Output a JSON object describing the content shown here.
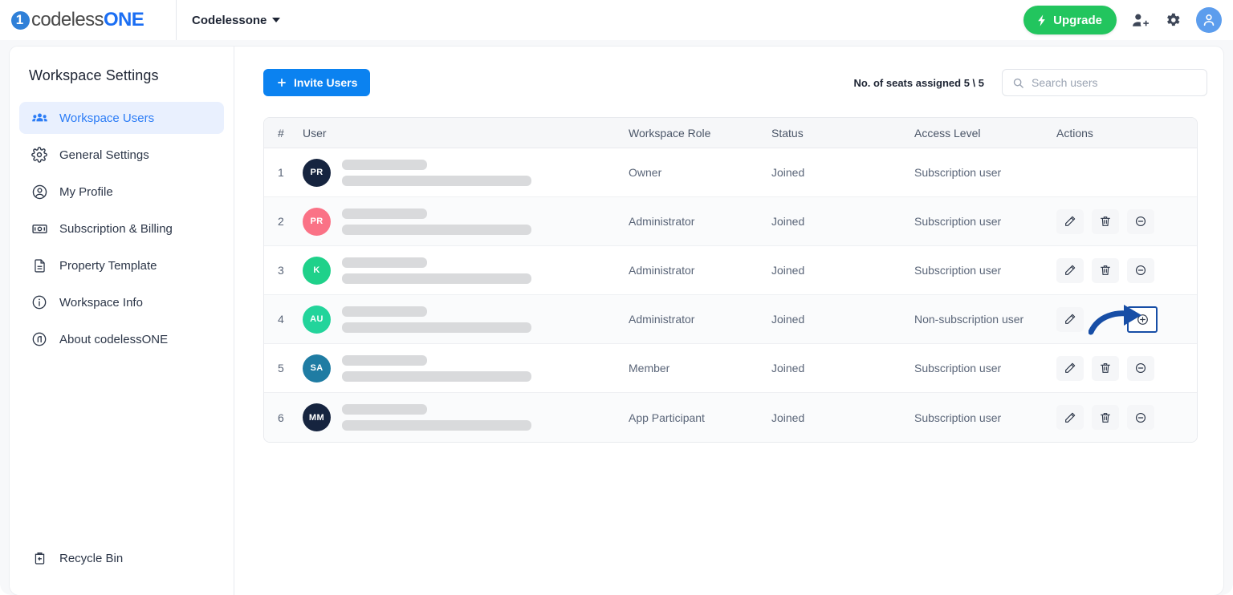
{
  "topbar": {
    "logo_part1": "codeless",
    "logo_part2": "ONE",
    "logo_mark_digit": "1",
    "workspace_name": "Codelessone",
    "upgrade_label": "Upgrade",
    "icons": {
      "bolt": "bolt-icon",
      "add_user": "add-user-icon",
      "gear": "gear-icon",
      "avatar": "user-avatar-icon",
      "caret": "chevron-down-icon"
    }
  },
  "sidebar": {
    "title": "Workspace Settings",
    "items": [
      {
        "label": "Workspace Users",
        "icon": "users-icon",
        "active": true
      },
      {
        "label": "General Settings",
        "icon": "gear-icon",
        "active": false
      },
      {
        "label": "My Profile",
        "icon": "user-circle-icon",
        "active": false
      },
      {
        "label": "Subscription & Billing",
        "icon": "banknote-icon",
        "active": false
      },
      {
        "label": "Property Template",
        "icon": "document-icon",
        "active": false
      },
      {
        "label": "Workspace Info",
        "icon": "info-circle-icon",
        "active": false
      },
      {
        "label": "About codelessONE",
        "icon": "copyright-icon",
        "active": false
      }
    ],
    "footer": {
      "label": "Recycle Bin",
      "icon": "recycle-bin-icon"
    }
  },
  "main": {
    "invite_button": "Invite Users",
    "seats_text": "No. of seats assigned 5 \\ 5",
    "search_placeholder": "Search users",
    "search_value": "",
    "search_icon": "search-icon",
    "table": {
      "columns": [
        "#",
        "User",
        "Workspace Role",
        "Status",
        "Access Level",
        "Actions"
      ],
      "rows": [
        {
          "num": "1",
          "initials": "PR",
          "avatar_color": "#16243f",
          "role": "Owner",
          "status": "Joined",
          "access": "Subscription user",
          "actions": []
        },
        {
          "num": "2",
          "initials": "PR",
          "avatar_color": "#fa7286",
          "role": "Administrator",
          "status": "Joined",
          "access": "Subscription user",
          "actions": [
            "edit",
            "delete",
            "block"
          ]
        },
        {
          "num": "3",
          "initials": "K",
          "avatar_color": "#1fd18a",
          "role": "Administrator",
          "status": "Joined",
          "access": "Subscription user",
          "actions": [
            "edit",
            "delete",
            "block"
          ]
        },
        {
          "num": "4",
          "initials": "AU",
          "avatar_color": "#23d49b",
          "role": "Administrator",
          "status": "Joined",
          "access": "Non-subscription user",
          "actions": [
            "edit",
            "highlighted-add"
          ]
        },
        {
          "num": "5",
          "initials": "SA",
          "avatar_color": "#1f7ca3",
          "role": "Member",
          "status": "Joined",
          "access": "Subscription user",
          "actions": [
            "edit",
            "delete",
            "block"
          ]
        },
        {
          "num": "6",
          "initials": "MM",
          "avatar_color": "#16243f",
          "role": "App Participant",
          "status": "Joined",
          "access": "Subscription user",
          "actions": [
            "edit",
            "delete",
            "block"
          ]
        }
      ]
    }
  },
  "annotation": {
    "type": "curved-arrow",
    "color": "#174ea6",
    "points_to": "add-subscription-button-row-4"
  },
  "colors": {
    "accent_blue": "#0b82f0",
    "upgrade_green": "#22c55e",
    "sidebar_active_bg": "#e9f0fe",
    "sidebar_active_text": "#2b7cf6",
    "annotation_blue": "#174ea6"
  }
}
